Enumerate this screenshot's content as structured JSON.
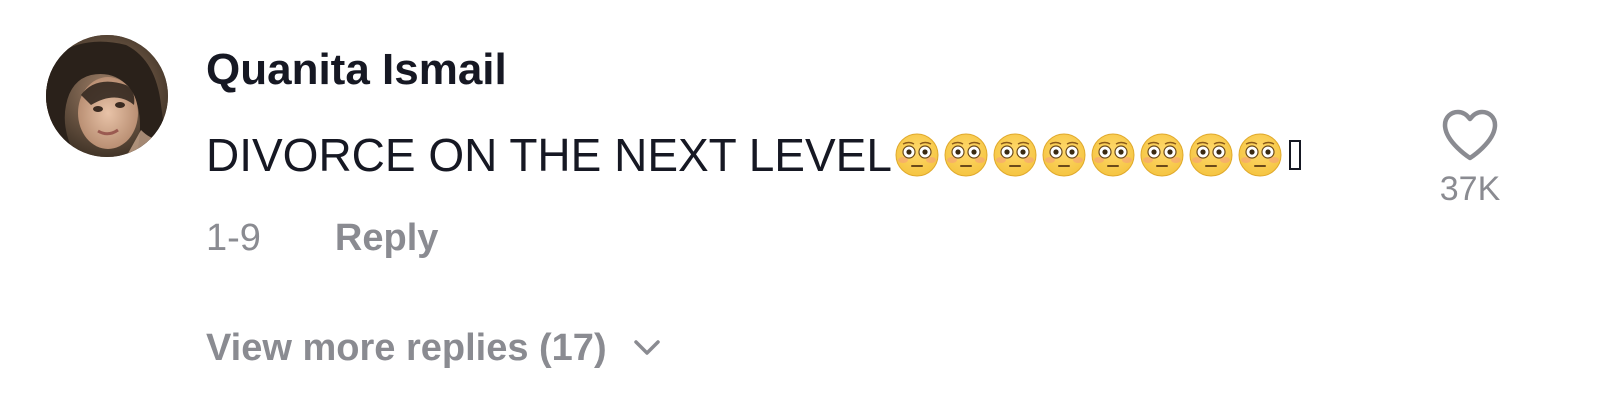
{
  "comment": {
    "username": "Quanita Ismail",
    "text": "DIVORCE ON THE NEXT LEVEL",
    "emoji_name": "flushed-face-emoji",
    "emoji_count": 8,
    "date": "1-9",
    "reply_label": "Reply",
    "view_more_label": "View more replies (17)",
    "like_count": "37K"
  },
  "colors": {
    "text_primary": "#161823",
    "text_secondary": "#8a8b91",
    "background": "#ffffff",
    "emoji_face": "#f5c542"
  },
  "icons": {
    "like": "heart-outline-icon",
    "expand": "chevron-down-icon",
    "avatar": "user-avatar-photo"
  }
}
